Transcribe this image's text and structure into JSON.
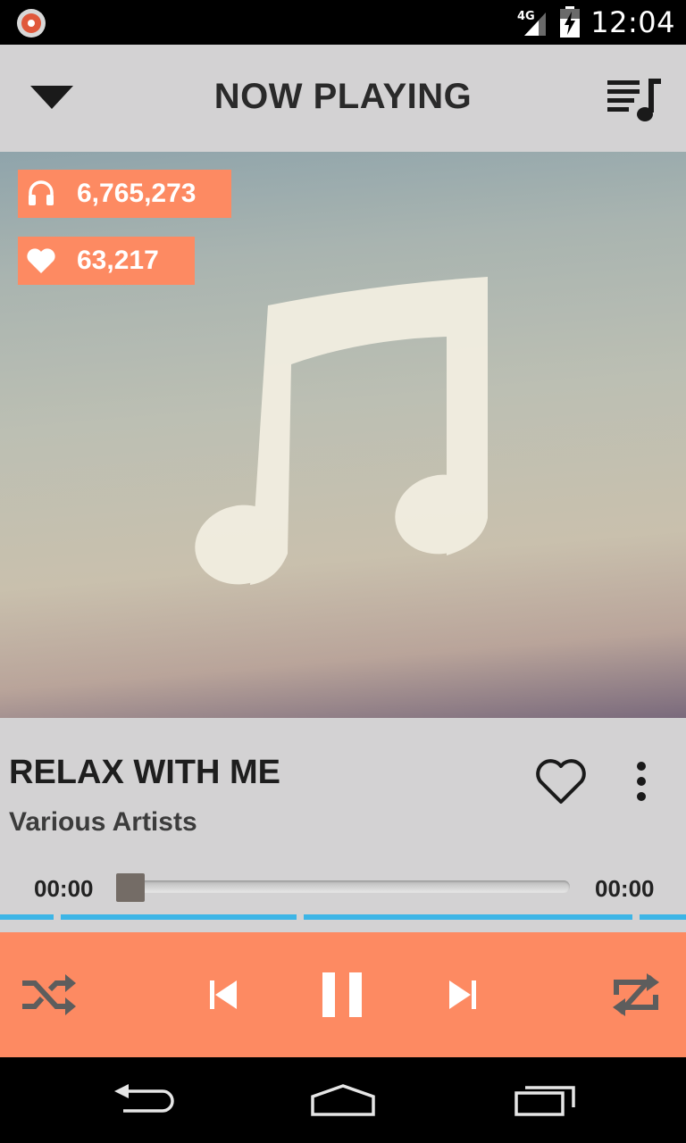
{
  "status_bar": {
    "time": "12:04",
    "network_label": "4G",
    "icons": [
      "app-notification-icon",
      "signal-icon",
      "battery-charging-icon"
    ]
  },
  "app_bar": {
    "title": "NOW PLAYING",
    "collapse_icon": "chevron-down-icon",
    "queue_icon": "playlist-icon"
  },
  "artwork": {
    "placeholder_icon": "music-note-icon",
    "plays": {
      "icon": "headphones-icon",
      "value": "6,765,273"
    },
    "likes": {
      "icon": "heart-icon",
      "value": "63,217"
    }
  },
  "track": {
    "title": "RELAX WITH ME",
    "artist": "Various Artists",
    "favorite_icon": "heart-outline-icon",
    "more_icon": "more-vertical-icon"
  },
  "progress": {
    "current_time": "00:00",
    "total_time": "00:00",
    "position_fraction": 0.0
  },
  "controls": {
    "shuffle_icon": "shuffle-icon",
    "previous_icon": "skip-previous-icon",
    "pause_icon": "pause-icon",
    "next_icon": "skip-next-icon",
    "repeat_icon": "repeat-icon"
  },
  "nav_bar": {
    "back_icon": "back-icon",
    "home_icon": "home-icon",
    "recents_icon": "recents-icon"
  },
  "colors": {
    "accent": "#fd8a62",
    "panel": "#d3d2d3",
    "buffer": "#3db5e6",
    "text_dark": "#1e1e1e"
  }
}
